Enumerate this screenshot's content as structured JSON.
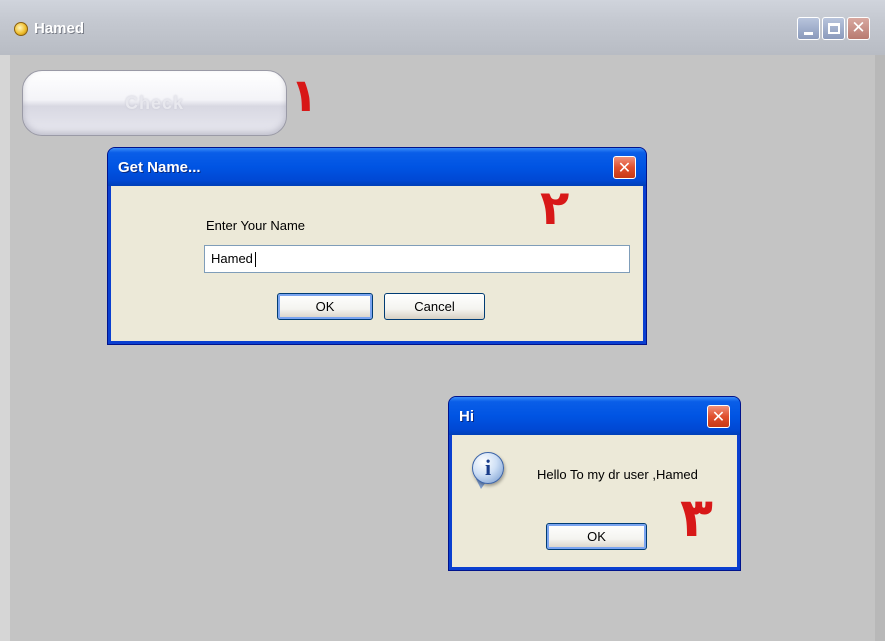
{
  "main_window": {
    "title": "Hamed",
    "check_button_label": "Check"
  },
  "annotations": {
    "step1": "١",
    "step2": "٢",
    "step3": "٣",
    "color": "#d81818"
  },
  "get_name_dialog": {
    "title": "Get Name...",
    "prompt": "Enter Your Name",
    "input_value": "Hamed",
    "ok_label": "OK",
    "cancel_label": "Cancel"
  },
  "hi_dialog": {
    "title": "Hi",
    "message": "Hello To my dr user ,Hamed",
    "ok_label": "OK",
    "icon": "info-icon"
  },
  "colors": {
    "xp_title_blue": "#0054e3",
    "dialog_face": "#ece9d8",
    "window_body": "#c4c4c4"
  }
}
